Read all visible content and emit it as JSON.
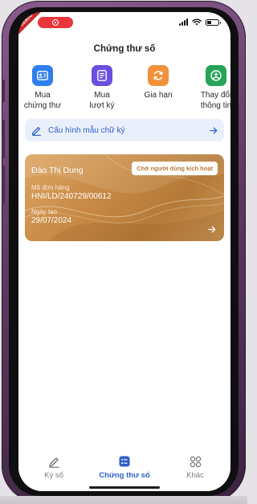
{
  "status_bar": {
    "debug_label": "DEBUG"
  },
  "header": {
    "title": "Chứng thư số"
  },
  "actions": [
    {
      "label_line1": "Mua",
      "label_line2": "chứng thư",
      "icon": "id-card-icon",
      "color": "#2f80ed"
    },
    {
      "label_line1": "Mua",
      "label_line2": "lượt ký",
      "icon": "document-list-icon",
      "color": "#6c4fe0"
    },
    {
      "label_line1": "Gia hạn",
      "label_line2": "",
      "icon": "renew-icon",
      "color": "#f0923a"
    },
    {
      "label_line1": "Thay đổi",
      "label_line2": "thông tin",
      "icon": "user-circle-icon",
      "color": "#27a35a"
    }
  ],
  "config_bar": {
    "label": "Cấu hình mẫu chữ ký",
    "icon": "pencil-icon",
    "arrow_icon": "arrow-right-icon",
    "accent": "#2e5fc7"
  },
  "certificate_card": {
    "holder_name": "Đào Thị Dung",
    "status_badge": "Chờ người dùng kích hoạt",
    "order_label": "Mã đơn hàng",
    "order_value": "HNI/LD/240729/00612",
    "date_label": "Ngày tạo",
    "date_value": "29/07/2024",
    "colors": {
      "gold": "#c88a45"
    }
  },
  "tab_bar": {
    "tabs": [
      {
        "label": "Ký số",
        "icon": "pen-icon",
        "active": false
      },
      {
        "label": "Chứng thư số",
        "icon": "certificate-icon",
        "active": true
      },
      {
        "label": "Khác",
        "icon": "grid-icon",
        "active": false
      }
    ],
    "active_color": "#2e5fc7"
  }
}
